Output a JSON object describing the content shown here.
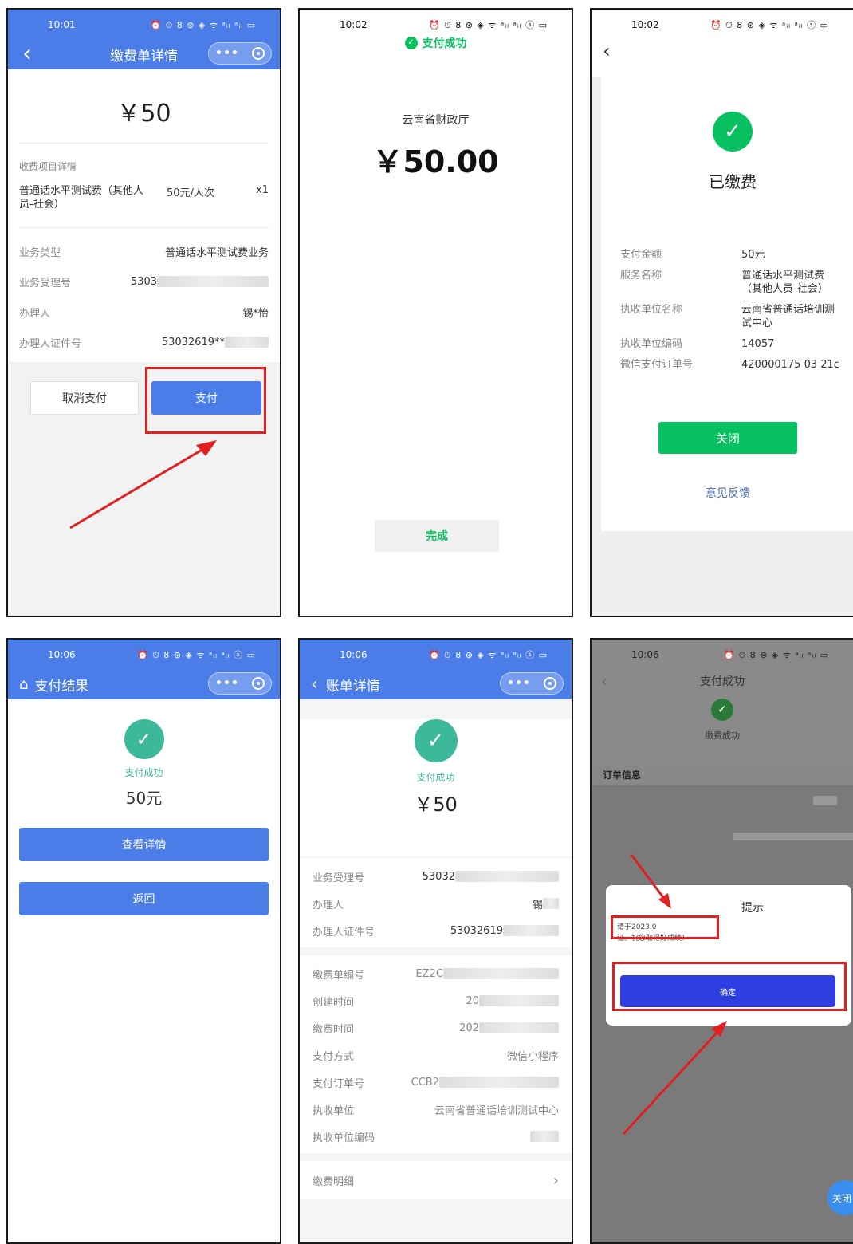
{
  "p1": {
    "time": "10:01",
    "status_icons": "⏰ ⏱ 8 ⊛ ◈ ᯤ ᵃᵢₗ ᵃᵢₗ ▭",
    "back": "‹",
    "title": "缴费单详情",
    "capsule_dots": "•••",
    "amount": "￥50",
    "section_label": "收费项目详情",
    "item_name": "普通话水平测试费（其他人员-社会）",
    "item_price": "50元/人次",
    "item_qty": "x1",
    "rows": [
      {
        "label": "业务类型",
        "value": "普通话水平测试费业务"
      },
      {
        "label": "业务受理号",
        "value": "5303"
      },
      {
        "label": "办理人",
        "value": "锡*怡"
      },
      {
        "label": "办理人证件号",
        "value": "53032619**"
      }
    ],
    "cancel_btn": "取消支付",
    "pay_btn": "支付"
  },
  "p2": {
    "time": "10:02",
    "status_icons": "⏰ ⏱ 8 ⊛ ◈ ᯤ ᵃᵢₗ ᵃᵢₗ ⓢ ▭",
    "success_title": "支付成功",
    "merchant": "云南省财政厅",
    "amount": "￥50.00",
    "done_btn": "完成"
  },
  "p3": {
    "time": "10:02",
    "status_icons": "⏰ ⏱ 8 ⊛ ◈ ᯤ ᵃᵢₗ ᵃᵢₗ ⓢ ▭",
    "back": "‹",
    "heading": "已缴费",
    "rows": [
      {
        "label": "支付金额",
        "value": "50元"
      },
      {
        "label": "服务名称",
        "value": "普通话水平测试费（其他人员-社会）"
      },
      {
        "label": "执收单位名称",
        "value": "云南省普通话培训测试中心"
      },
      {
        "label": "执收单位编码",
        "value": "14057"
      },
      {
        "label": "微信支付订单号",
        "value": "420000175 03 21c"
      }
    ],
    "close_btn": "关闭",
    "feedback": "意见反馈"
  },
  "p4": {
    "time": "10:06",
    "status_icons": "⏰ ⏱ 8 ⊛ ◈ ᯤ ᵃᵢₗ ᵃᵢₗ ⓢ ▭",
    "home": "⌂",
    "title": "支付结果",
    "capsule_dots": "•••",
    "success": "支付成功",
    "amount": "50元",
    "detail_btn": "查看详情",
    "back_btn": "返回"
  },
  "p5": {
    "time": "10:06",
    "status_icons": "⏰ ⏱ 8 ⊛ ◈ ᯤ ᵃᵢₗ ᵃᵢₗ ⓢ ▭",
    "back": "‹",
    "title": "账单详情",
    "capsule_dots": "•••",
    "success": "支付成功",
    "amount": "￥50",
    "group1": [
      {
        "label": "业务受理号",
        "value": "53032"
      },
      {
        "label": "办理人",
        "value": "锡"
      },
      {
        "label": "办理人证件号",
        "value": "53032619"
      }
    ],
    "group2": [
      {
        "label": "缴费单编号",
        "value": "EZ2C"
      },
      {
        "label": "创建时间",
        "value": "20"
      },
      {
        "label": "缴费时间",
        "value": "202"
      },
      {
        "label": "支付方式",
        "value": "微信小程序"
      },
      {
        "label": "支付订单号",
        "value": "CCB2"
      },
      {
        "label": "执收单位",
        "value": "云南省普通话培训测试中心"
      },
      {
        "label": "执收单位编码",
        "value": ""
      }
    ],
    "detail_link": "缴费明细"
  },
  "p6": {
    "time": "10:06",
    "status_icons": "⏰ ⏱ 8 ⊛ ◈ ᯤ ᵃᵢₗ ᵃᵢₗ ▭",
    "title": "支付成功",
    "subtitle": "缴费成功",
    "order_info": "订单信息",
    "dialog_title": "提示",
    "dialog_line1": "请于2023.0",
    "dialog_line2": "证。祝您取得好成绩！",
    "confirm_btn": "确定",
    "float_btn": "关闭"
  },
  "colors": {
    "blue": "#4a7de8",
    "green": "#07c160",
    "red": "#e02020"
  }
}
